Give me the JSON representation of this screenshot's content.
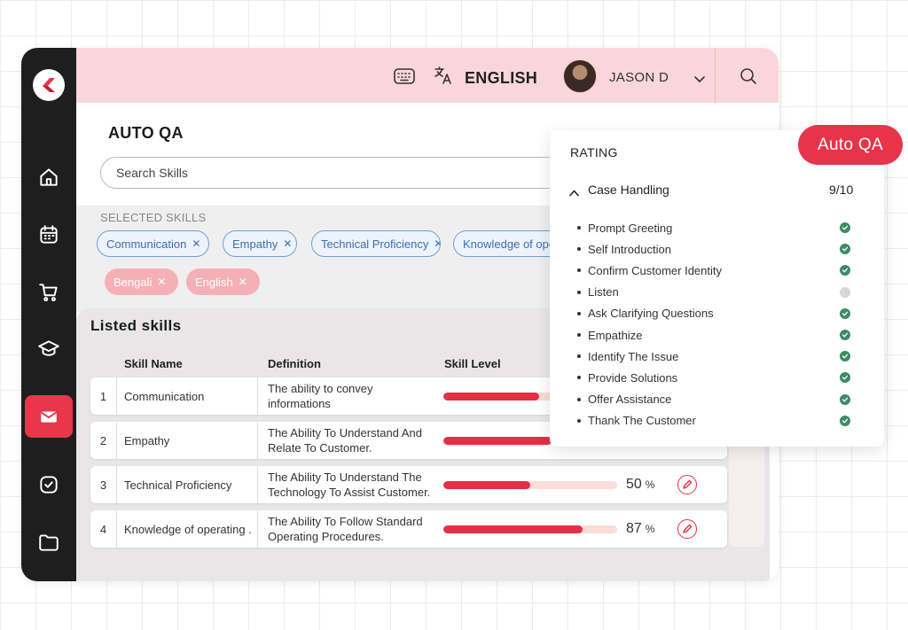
{
  "topbar": {
    "language": "ENGLISH",
    "user_name": "JASON D"
  },
  "page": {
    "title": "AUTO QA"
  },
  "search": {
    "placeholder": "Search Skills"
  },
  "selected_skills": {
    "label": "SELECTED SKILLS",
    "skills": [
      "Communication",
      "Empathy",
      "Technical Proficiency",
      "Knowledge of ope"
    ],
    "languages": [
      "Bengali",
      "English"
    ]
  },
  "listed": {
    "title": "Listed skills",
    "columns": [
      "Skill Name",
      "Definition",
      "Skill Level"
    ],
    "rows": [
      {
        "num": "1",
        "name": "Communication",
        "definition": "The ability to convey informations",
        "level": 0.55,
        "pct": ""
      },
      {
        "num": "2",
        "name": "Empathy",
        "definition": "The Ability To Understand And Relate To Customer.",
        "level": 0.62,
        "pct": ""
      },
      {
        "num": "3",
        "name": "Technical Proficiency",
        "definition": "The Ability To Understand The Technology To Assist Customer.",
        "level": 0.5,
        "pct": "50"
      },
      {
        "num": "4",
        "name": "Knowledge of operating ....",
        "definition": "The Ability To Follow Standard Operating Procedures.",
        "level": 0.8,
        "pct": "87"
      }
    ],
    "pct_symbol": "%"
  },
  "rating": {
    "title": "RATING",
    "category": "Case Handling",
    "score": "9/10",
    "criteria": [
      {
        "label": "Prompt Greeting",
        "status": "ok"
      },
      {
        "label": "Self Introduction",
        "status": "ok"
      },
      {
        "label": "Confirm Customer Identity",
        "status": "ok"
      },
      {
        "label": "Listen",
        "status": "no"
      },
      {
        "label": "Ask Clarifying Questions",
        "status": "ok"
      },
      {
        "label": "Empathize",
        "status": "ok"
      },
      {
        "label": "Identify The Issue",
        "status": "ok"
      },
      {
        "label": "Provide Solutions",
        "status": "ok"
      },
      {
        "label": "Offer Assistance",
        "status": "ok"
      },
      {
        "label": "Thank The Customer",
        "status": "ok"
      }
    ]
  },
  "badge": {
    "label": "Auto QA"
  },
  "colors": {
    "accent": "#e8364a",
    "topbar": "#fad6da",
    "sidebar": "#1e1e1e",
    "ok": "#3d8a66"
  }
}
